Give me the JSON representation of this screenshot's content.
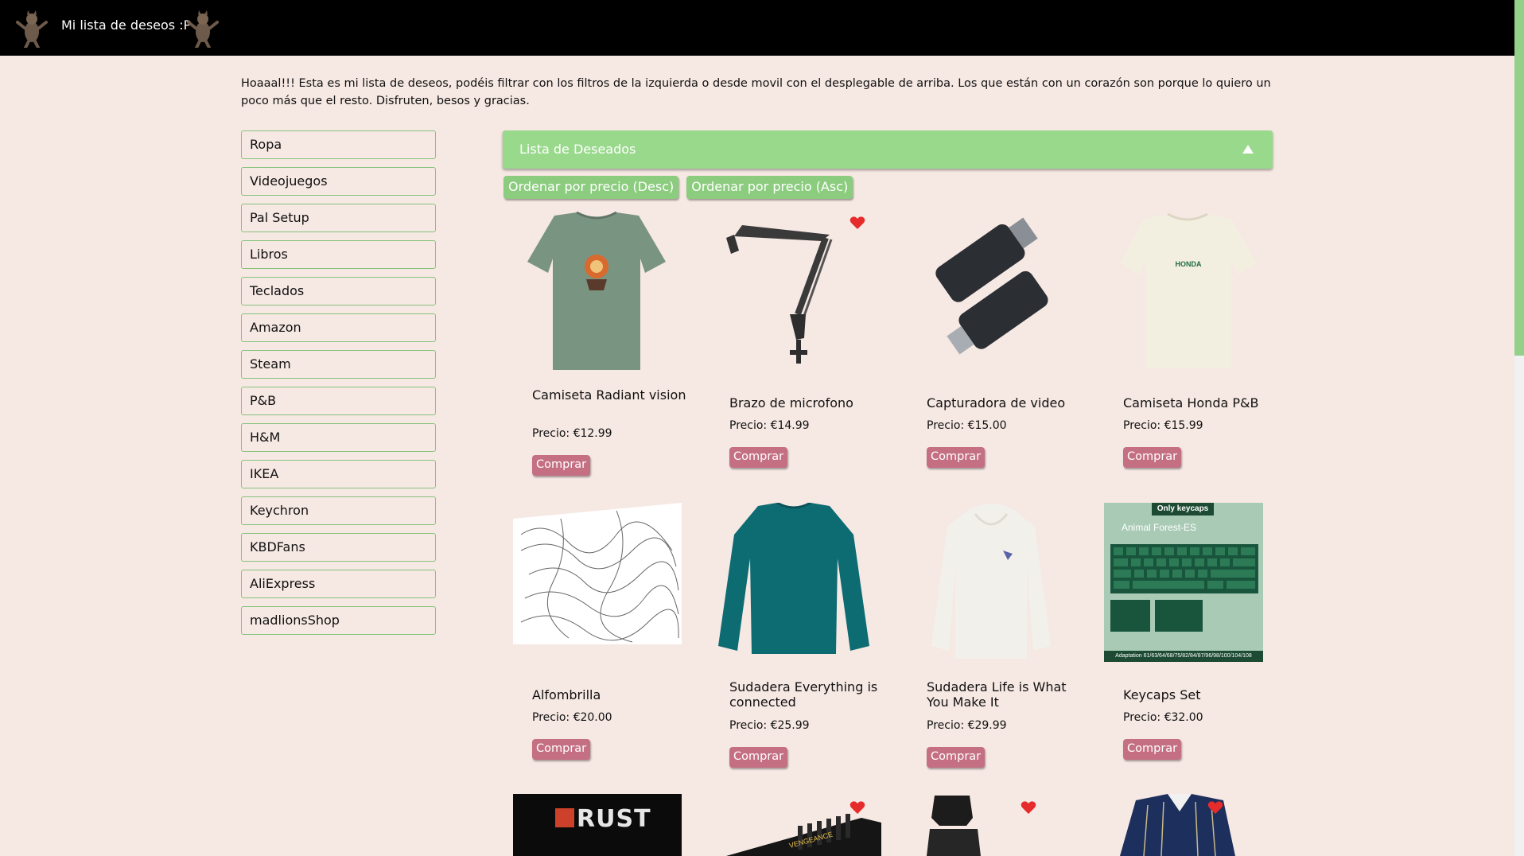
{
  "header": {
    "title": "Mi lista de deseos :P"
  },
  "intro": "Hoaaal!!! Esta es mi lista de deseos, podéis filtrar con los filtros de la izquierda o desde movil con el desplegable de arriba. Los que están con un corazón son porque lo quiero un poco más que el resto. Disfruten, besos y gracias.",
  "filters": [
    "Ropa",
    "Videojuegos",
    "Pal Setup",
    "Libros",
    "Teclados",
    "Amazon",
    "Steam",
    "P&B",
    "H&M",
    "IKEA",
    "Keychron",
    "KBDFans",
    "AliExpress",
    "madlionsShop"
  ],
  "accordion": {
    "label": "Lista de Deseados"
  },
  "sort": {
    "desc": "Ordenar por precio (Desc)",
    "asc": "Ordenar por precio (Asc)"
  },
  "buy_label": "Comprar",
  "products": [
    {
      "name": "Camiseta Radiant vision",
      "price": "Precio: €12.99",
      "favorite": false
    },
    {
      "name": "Brazo de microfono",
      "price": "Precio: €14.99",
      "favorite": true
    },
    {
      "name": "Capturadora de video",
      "price": "Precio: €15.00",
      "favorite": false
    },
    {
      "name": "Camiseta Honda P&B",
      "price": "Precio: €15.99",
      "favorite": false
    },
    {
      "name": "Alfombrilla",
      "price": "Precio: €20.00",
      "favorite": false
    },
    {
      "name": "Sudadera Everything is connected",
      "price": "Precio: €25.99",
      "favorite": false
    },
    {
      "name": "Sudadera Life is What You Make It",
      "price": "Precio: €29.99",
      "favorite": false
    },
    {
      "name": "Keycaps Set",
      "price": "Precio: €32.00",
      "favorite": false
    }
  ],
  "image_texts": {
    "keycaps_badge": "Only keycaps",
    "keycaps_title": "Animal Forest-ES",
    "keycaps_footer": "Adaptation 61/63/64/68/75/82/84/87/96/98/100/104/108",
    "rust_logo": "RUST",
    "ram_brand": "VENGEANCE"
  },
  "colors": {
    "accent": "#99d98c",
    "buy": "#c56f83",
    "background": "#f6e8e3",
    "header": "#000000"
  }
}
